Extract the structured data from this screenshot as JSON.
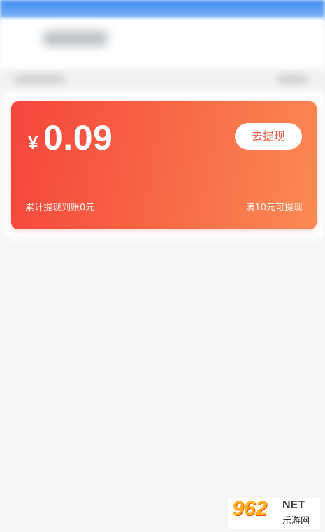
{
  "wallet": {
    "currency_symbol": "¥",
    "balance": "0.09",
    "withdraw_button": "去提现",
    "total_withdrawn": "累计提现到账0元",
    "min_withdraw": "满10元可提现",
    "gradient_start": "#f6453d",
    "gradient_end": "#fb8a54"
  },
  "watermark": {
    "logo": "962",
    "net": "NET",
    "site": "乐游网"
  }
}
